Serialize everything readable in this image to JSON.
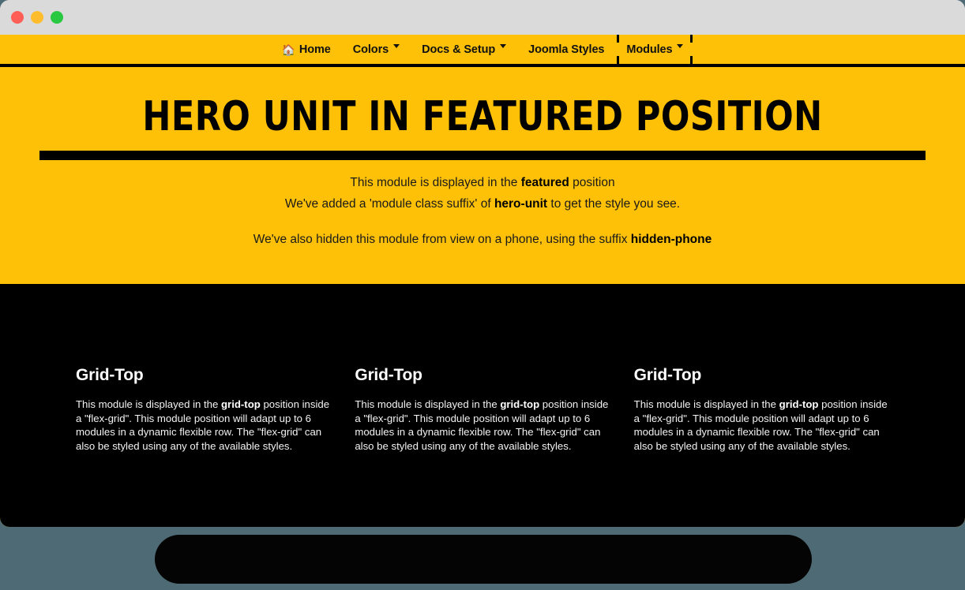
{
  "window": {
    "traffic_lights": [
      {
        "name": "close",
        "color": "#ff5f57"
      },
      {
        "name": "minimize",
        "color": "#ffbd2e"
      },
      {
        "name": "maximize",
        "color": "#28c840"
      }
    ]
  },
  "theme": {
    "brand_yellow": "#ffc107",
    "dark": "#000000",
    "page_chrome": "#dadada",
    "desktop": "#4e6b75",
    "text_on_yellow": "#111111",
    "text_on_dark": "#ffffff"
  },
  "nav": {
    "items": [
      {
        "label": "Home",
        "icon": "home-icon",
        "has_caret": false,
        "focused": false
      },
      {
        "label": "Colors",
        "icon": null,
        "has_caret": true,
        "focused": false
      },
      {
        "label": "Docs & Setup",
        "icon": null,
        "has_caret": true,
        "focused": false
      },
      {
        "label": "Joomla Styles",
        "icon": null,
        "has_caret": false,
        "focused": false
      },
      {
        "label": "Modules",
        "icon": null,
        "has_caret": true,
        "focused": true
      }
    ]
  },
  "hero": {
    "title": "Hero Unit in Featured Position",
    "paragraph1": {
      "pre": "This module is displayed in the ",
      "strong": "featured",
      "post": " position"
    },
    "paragraph2": {
      "pre": "We've added a 'module class suffix' of ",
      "strong": "hero-unit",
      "post": " to get the style you see."
    },
    "paragraph3": {
      "pre": "We've also hidden this module from view on a phone, using the suffix ",
      "strong": "hidden-phone",
      "post": ""
    }
  },
  "grid_top": {
    "modules": [
      {
        "title": "Grid-Top",
        "body_pre": "This module is displayed in the ",
        "body_strong": "grid-top",
        "body_post": " position inside a \"flex-grid\". This module position will adapt up to 6 modules in a dynamic flexible row. The \"flex-grid\" can also be styled using any of the available styles."
      },
      {
        "title": "Grid-Top",
        "body_pre": "This module is displayed in the ",
        "body_strong": "grid-top",
        "body_post": " position inside a \"flex-grid\". This module position will adapt up to 6 modules in a dynamic flexible row. The \"flex-grid\" can also be styled using any of the available styles."
      },
      {
        "title": "Grid-Top",
        "body_pre": "This module is displayed in the ",
        "body_strong": "grid-top",
        "body_post": " position inside a \"flex-grid\". This module position will adapt up to 6 modules in a dynamic flexible row. The \"flex-grid\" can also be styled using any of the available styles."
      }
    ]
  }
}
